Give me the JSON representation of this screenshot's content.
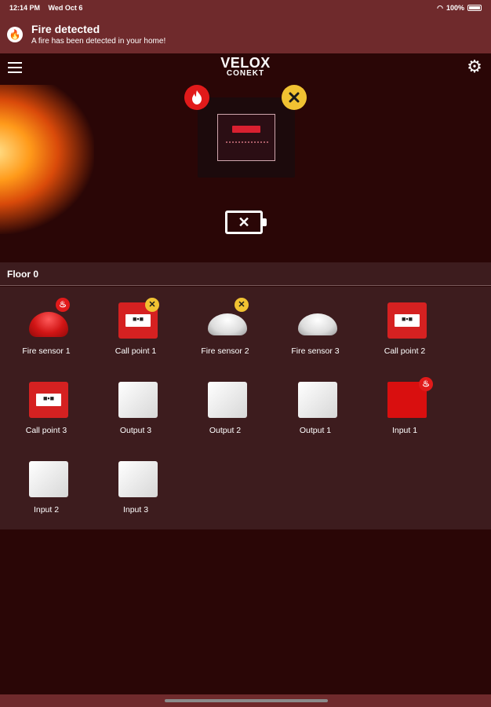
{
  "status": {
    "time": "12:14 PM",
    "date": "Wed Oct 6",
    "battery": "100%"
  },
  "notification": {
    "title": "Fire detected",
    "message": "A fire has been detected in your home!"
  },
  "header": {
    "logo_line1": "VELOX",
    "logo_line2": "CONEKT"
  },
  "floor": {
    "title": "Floor 0",
    "devices": [
      {
        "label": "Fire sensor 1",
        "kind": "sensor-red",
        "badge": "fire"
      },
      {
        "label": "Call point 1",
        "kind": "callpoint",
        "badge": "fault"
      },
      {
        "label": "Fire sensor 2",
        "kind": "sensor-white",
        "badge": "fault"
      },
      {
        "label": "Fire sensor 3",
        "kind": "sensor-white",
        "badge": ""
      },
      {
        "label": "Call point 2",
        "kind": "callpoint",
        "badge": ""
      },
      {
        "label": "Call point 3",
        "kind": "callpoint",
        "badge": ""
      },
      {
        "label": "Output 3",
        "kind": "box-white",
        "badge": ""
      },
      {
        "label": "Output 2",
        "kind": "box-white",
        "badge": ""
      },
      {
        "label": "Output 1",
        "kind": "box-white",
        "badge": ""
      },
      {
        "label": "Input 1",
        "kind": "box-red",
        "badge": "fire"
      },
      {
        "label": "Input 2",
        "kind": "box-white",
        "badge": ""
      },
      {
        "label": "Input 3",
        "kind": "box-white",
        "badge": ""
      }
    ]
  },
  "colors": {
    "background": "#2a0606",
    "banner": "#6f2a2c",
    "fire": "#e11a1a",
    "fault": "#f1c232"
  },
  "icons": {
    "menu": "menu-icon",
    "settings": "gear-icon",
    "fire": "flame-icon",
    "fault": "close-icon",
    "battery": "battery-fault-icon"
  }
}
